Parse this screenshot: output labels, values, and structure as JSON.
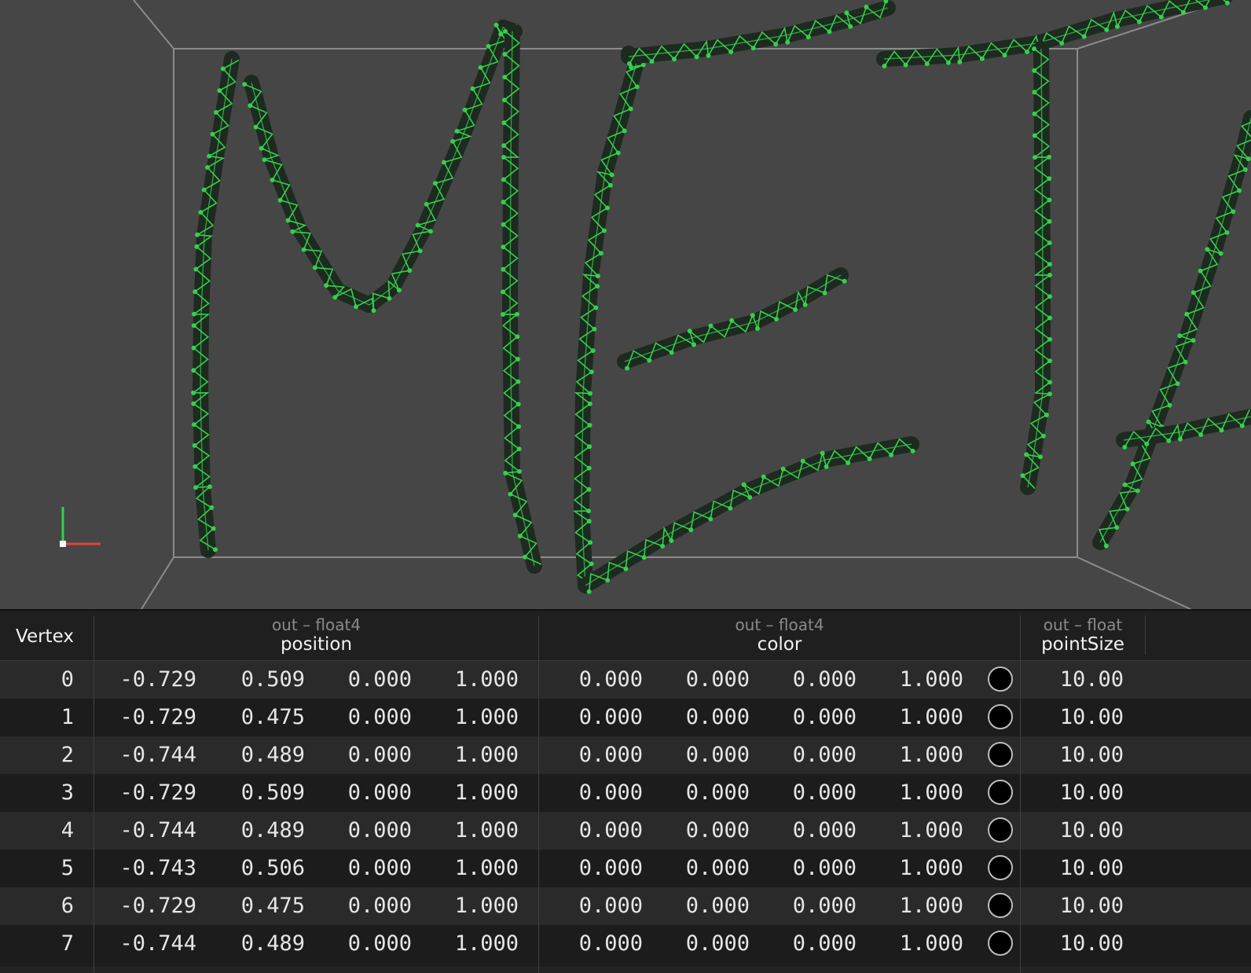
{
  "viewport": {
    "mesh_color": "#33d14d",
    "background_color": "#464646",
    "frame_color": "#8c8c8c",
    "axis_colors": {
      "x": "#e0443e",
      "y": "#33d14d"
    }
  },
  "table": {
    "vertex_header": "Vertex",
    "columns": [
      {
        "sub": "out – float4",
        "title": "position"
      },
      {
        "sub": "out – float4",
        "title": "color"
      },
      {
        "sub": "out – float",
        "title": "pointSize"
      }
    ],
    "rows": [
      {
        "index": "0",
        "position": [
          "-0.729",
          "0.509",
          "0.000",
          "1.000"
        ],
        "color": [
          "0.000",
          "0.000",
          "0.000",
          "1.000"
        ],
        "pointSize": "10.00"
      },
      {
        "index": "1",
        "position": [
          "-0.729",
          "0.475",
          "0.000",
          "1.000"
        ],
        "color": [
          "0.000",
          "0.000",
          "0.000",
          "1.000"
        ],
        "pointSize": "10.00"
      },
      {
        "index": "2",
        "position": [
          "-0.744",
          "0.489",
          "0.000",
          "1.000"
        ],
        "color": [
          "0.000",
          "0.000",
          "0.000",
          "1.000"
        ],
        "pointSize": "10.00"
      },
      {
        "index": "3",
        "position": [
          "-0.729",
          "0.509",
          "0.000",
          "1.000"
        ],
        "color": [
          "0.000",
          "0.000",
          "0.000",
          "1.000"
        ],
        "pointSize": "10.00"
      },
      {
        "index": "4",
        "position": [
          "-0.744",
          "0.489",
          "0.000",
          "1.000"
        ],
        "color": [
          "0.000",
          "0.000",
          "0.000",
          "1.000"
        ],
        "pointSize": "10.00"
      },
      {
        "index": "5",
        "position": [
          "-0.743",
          "0.506",
          "0.000",
          "1.000"
        ],
        "color": [
          "0.000",
          "0.000",
          "0.000",
          "1.000"
        ],
        "pointSize": "10.00"
      },
      {
        "index": "6",
        "position": [
          "-0.729",
          "0.475",
          "0.000",
          "1.000"
        ],
        "color": [
          "0.000",
          "0.000",
          "0.000",
          "1.000"
        ],
        "pointSize": "10.00"
      },
      {
        "index": "7",
        "position": [
          "-0.744",
          "0.489",
          "0.000",
          "1.000"
        ],
        "color": [
          "0.000",
          "0.000",
          "0.000",
          "1.000"
        ],
        "pointSize": "10.00"
      }
    ]
  }
}
